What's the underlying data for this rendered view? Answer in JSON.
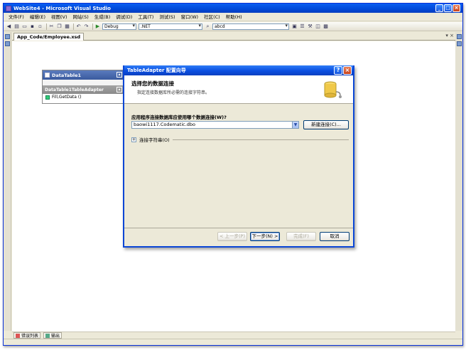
{
  "window": {
    "title": "WebSite4 - Microsoft Visual Studio"
  },
  "menu": [
    "文件(F)",
    "编辑(E)",
    "视图(V)",
    "网站(S)",
    "生成(B)",
    "调试(D)",
    "工具(T)",
    "测试(S)",
    "窗口(W)",
    "社区(C)",
    "帮助(H)"
  ],
  "toolbar": {
    "config": "Debug",
    "platform": ".NET",
    "find": "abcd"
  },
  "document_tab": "App_Code/Employee.xsd",
  "designer": {
    "table_name": "DataTable1",
    "adapter_name": "DataTable1TableAdapter",
    "method": "Fill,GetData ()"
  },
  "dialog": {
    "title": "TableAdapter 配置向导",
    "banner_title": "选择您的数据连接",
    "banner_desc": "指定连接数据库所必需的连接字符串。",
    "connection_question": "应用程序连接数据库应使用哪个数据连接(W)?",
    "connection_value": "baowi1117.Codematic.dbo",
    "new_connection": "新建连接(C)...",
    "connection_string_label": "连接字符串(O)",
    "buttons": {
      "prev": "< 上一步(P)",
      "next": "下一步(N) >",
      "finish": "完成(F)",
      "cancel": "取消"
    }
  },
  "bottom_tabs": [
    "错误列表",
    "输出"
  ]
}
